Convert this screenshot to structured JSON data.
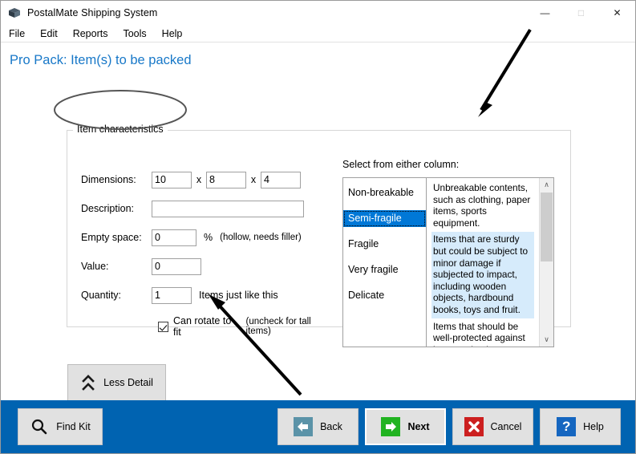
{
  "window": {
    "title": "PostalMate Shipping System",
    "app_icon": "box-icon",
    "controls": {
      "minimize": "—",
      "maximize": "□",
      "close": "✕"
    }
  },
  "menubar": {
    "items": [
      "File",
      "Edit",
      "Reports",
      "Tools",
      "Help"
    ]
  },
  "page": {
    "title": "Pro Pack: Item(s) to be packed",
    "title_color": "#1878c8"
  },
  "group": {
    "label": "Item characteristics",
    "fields": {
      "dimensions": {
        "label": "Dimensions:",
        "length": "10",
        "width": "8",
        "height": "4",
        "separator": "x"
      },
      "description": {
        "label": "Description:",
        "value": "",
        "placeholder": ""
      },
      "empty_space": {
        "label": "Empty space:",
        "value": "0",
        "unit": "%",
        "hint": "(hollow, needs filler)"
      },
      "value": {
        "label": "Value:",
        "value": "0"
      },
      "quantity": {
        "label": "Quantity:",
        "value": "1",
        "suffix": "Items just like this"
      },
      "rotate": {
        "label": "Can rotate to fit",
        "hint": "(uncheck for tall items)",
        "checked": true
      }
    }
  },
  "selection": {
    "hint": "Select from either column:",
    "selected": "Semi-fragile",
    "items": [
      "Non-breakable",
      "Semi-fragile",
      "Fragile",
      "Very fragile",
      "Delicate"
    ],
    "descriptions": [
      "Unbreakable contents, such as clothing, paper items, sports equipment.",
      "Items that are sturdy but could be subject to minor damage if subjected to impact, including wooden objects, hardbound books, toys and fruit.",
      "Items that should be well-protected against impact, shock, or vibration. Examples are small appliances, inexpensive"
    ],
    "highlight_index": 1,
    "highlight_color": "#d6ebfb",
    "selected_color": "#0078d7",
    "scrollbar": {
      "up_arrow": "∧",
      "down_arrow": "∨"
    }
  },
  "less_detail": {
    "label": "Less Detail",
    "icon": "double-chevron-up-icon"
  },
  "footer": {
    "background": "#0063b1",
    "find_kit": {
      "label": "Find Kit",
      "icon": "search-icon"
    },
    "buttons": [
      {
        "label": "Back",
        "icon": "arrow-left-icon",
        "glyph": "←",
        "focused": false
      },
      {
        "label": "Next",
        "icon": "arrow-right-icon",
        "glyph": "→",
        "focused": true
      },
      {
        "label": "Cancel",
        "icon": "close-x-icon",
        "glyph": "✖",
        "focused": false
      },
      {
        "label": "Help",
        "icon": "question-mark-icon",
        "glyph": "?",
        "focused": false
      }
    ]
  },
  "annotations": {
    "ellipse": "ellipse-around-item-characteristics",
    "arrow_top": "arrow-pointing-to-description-list",
    "arrow_bottom": "arrow-pointing-to-rotate-checkbox"
  }
}
